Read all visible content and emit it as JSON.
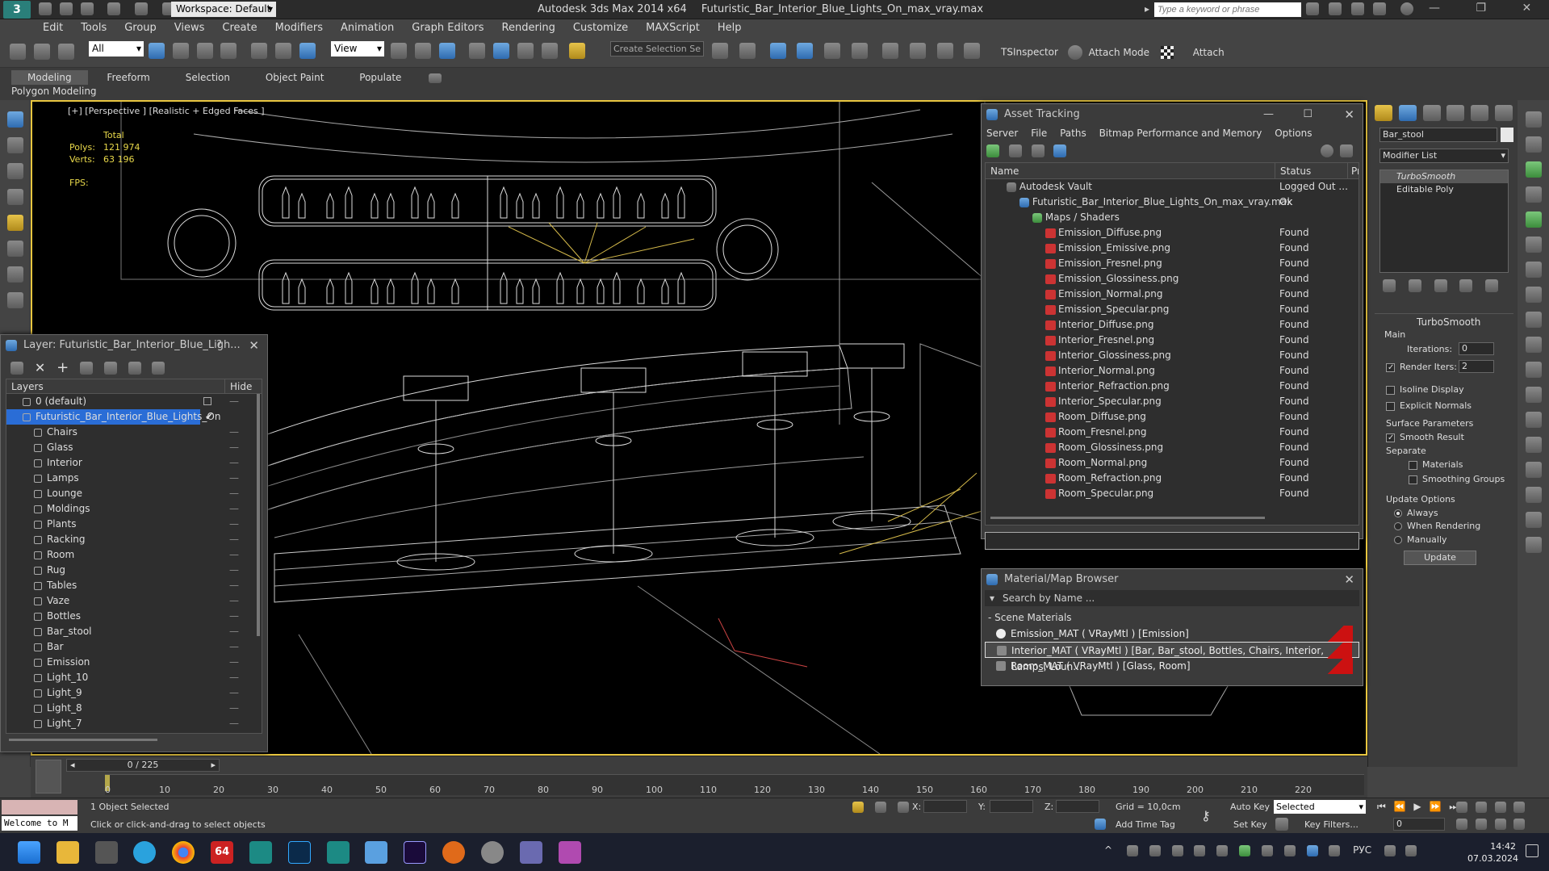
{
  "titlebar": {
    "workspace": "Workspace: Default",
    "app_title": "Autodesk 3ds Max  2014 x64",
    "file_title": "Futuristic_Bar_Interior_Blue_Lights_On_max_vray.max",
    "search_placeholder": "Type a keyword or phrase"
  },
  "menu": [
    "Edit",
    "Tools",
    "Group",
    "Views",
    "Create",
    "Modifiers",
    "Animation",
    "Graph Editors",
    "Rendering",
    "Customize",
    "MAXScript",
    "Help"
  ],
  "toolbar": {
    "selection_filter": "All",
    "ref_coord": "View",
    "selection_set_placeholder": "Create Selection Se",
    "tsinspector": "TSInspector",
    "attach_mode": "Attach Mode",
    "attach": "Attach"
  },
  "ribbon": {
    "tabs": [
      "Modeling",
      "Freeform",
      "Selection",
      "Object Paint",
      "Populate"
    ],
    "active_tab": "Modeling",
    "sub_label": "Polygon Modeling"
  },
  "viewport": {
    "label": "[+] [Perspective ] [Realistic + Edged Faces ]",
    "stats_header": "Total",
    "polys_label": "Polys:",
    "polys_value": "121 974",
    "verts_label": "Verts:",
    "verts_value": "63 196",
    "fps_label": "FPS:"
  },
  "layer_panel": {
    "title": "Layer: Futuristic_Bar_Interior_Blue_Ligh...",
    "help": "?",
    "col_layers": "Layers",
    "col_hide": "Hide",
    "default_layer": "0 (default)",
    "active_layer": "Futuristic_Bar_Interior_Blue_Lights_On",
    "children": [
      "Chairs",
      "Glass",
      "Interior",
      "Lamps",
      "Lounge",
      "Moldings",
      "Plants",
      "Racking",
      "Room",
      "Rug",
      "Tables",
      "Vaze",
      "Bottles",
      "Bar_stool",
      "Bar",
      "Emission",
      "Light_10",
      "Light_9",
      "Light_8",
      "Light_7"
    ]
  },
  "asset_tracking": {
    "title": "Asset Tracking",
    "menu": [
      "Server",
      "File",
      "Paths",
      "Bitmap Performance and Memory",
      "Options"
    ],
    "col_name": "Name",
    "col_status": "Status",
    "col_extra": "Pr",
    "vault": {
      "name": "Autodesk Vault",
      "status": "Logged Out ..."
    },
    "scene": {
      "name": "Futuristic_Bar_Interior_Blue_Lights_On_max_vray.max",
      "status": "Ok"
    },
    "maps_folder": "Maps / Shaders",
    "files": [
      {
        "name": "Emission_Diffuse.png",
        "status": "Found"
      },
      {
        "name": "Emission_Emissive.png",
        "status": "Found"
      },
      {
        "name": "Emission_Fresnel.png",
        "status": "Found"
      },
      {
        "name": "Emission_Glossiness.png",
        "status": "Found"
      },
      {
        "name": "Emission_Normal.png",
        "status": "Found"
      },
      {
        "name": "Emission_Specular.png",
        "status": "Found"
      },
      {
        "name": "Interior_Diffuse.png",
        "status": "Found"
      },
      {
        "name": "Interior_Fresnel.png",
        "status": "Found"
      },
      {
        "name": "Interior_Glossiness.png",
        "status": "Found"
      },
      {
        "name": "Interior_Normal.png",
        "status": "Found"
      },
      {
        "name": "Interior_Refraction.png",
        "status": "Found"
      },
      {
        "name": "Interior_Specular.png",
        "status": "Found"
      },
      {
        "name": "Room_Diffuse.png",
        "status": "Found"
      },
      {
        "name": "Room_Fresnel.png",
        "status": "Found"
      },
      {
        "name": "Room_Glossiness.png",
        "status": "Found"
      },
      {
        "name": "Room_Normal.png",
        "status": "Found"
      },
      {
        "name": "Room_Refraction.png",
        "status": "Found"
      },
      {
        "name": "Room_Specular.png",
        "status": "Found"
      }
    ]
  },
  "material_browser": {
    "title": "Material/Map Browser",
    "search_placeholder": "Search by Name ...",
    "group": "- Scene Materials",
    "materials": [
      "Emission_MAT ( VRayMtl ) [Emission]",
      "Interior_MAT ( VRayMtl ) [Bar, Bar_stool, Bottles, Chairs, Interior, Lamps, Loun...",
      "Room_MAT ( VRayMtl ) [Glass, Room]"
    ]
  },
  "command_panel": {
    "object_name": "Bar_stool",
    "modifier_list": "Modifier List",
    "stack": [
      "TurboSmooth",
      "Editable Poly"
    ],
    "rollout_title": "TurboSmooth",
    "main_label": "Main",
    "iterations_label": "Iterations:",
    "iterations_value": "0",
    "render_iters_label": "Render Iters:",
    "render_iters_value": "2",
    "isoline_display": "Isoline Display",
    "explicit_normals": "Explicit Normals",
    "surface_params": "Surface Parameters",
    "smooth_result": "Smooth Result",
    "separate": "Separate",
    "materials": "Materials",
    "smoothing_groups": "Smoothing Groups",
    "update_options": "Update Options",
    "always": "Always",
    "when_rendering": "When Rendering",
    "manually": "Manually",
    "update_btn": "Update"
  },
  "timeline": {
    "frame_counter": "0 / 225",
    "ticks": [
      "0",
      "10",
      "20",
      "30",
      "40",
      "50",
      "60",
      "70",
      "80",
      "90",
      "100",
      "110",
      "120",
      "130",
      "140",
      "150",
      "160",
      "170",
      "180",
      "190",
      "200",
      "210",
      "220"
    ]
  },
  "status": {
    "welcome": "Welcome to M",
    "selected": "1 Object Selected",
    "prompt": "Click or click-and-drag to select objects",
    "x_label": "X:",
    "y_label": "Y:",
    "z_label": "Z:",
    "grid": "Grid = 10,0cm",
    "add_time_tag": "Add Time Tag",
    "auto_key": "Auto Key",
    "set_key": "Set Key",
    "key_mode": "Selected",
    "key_filters": "Key Filters...",
    "frame": "0"
  },
  "taskbar": {
    "lang": "РУС",
    "time": "14:42",
    "date": "07.03.2024",
    "badge": "64"
  }
}
